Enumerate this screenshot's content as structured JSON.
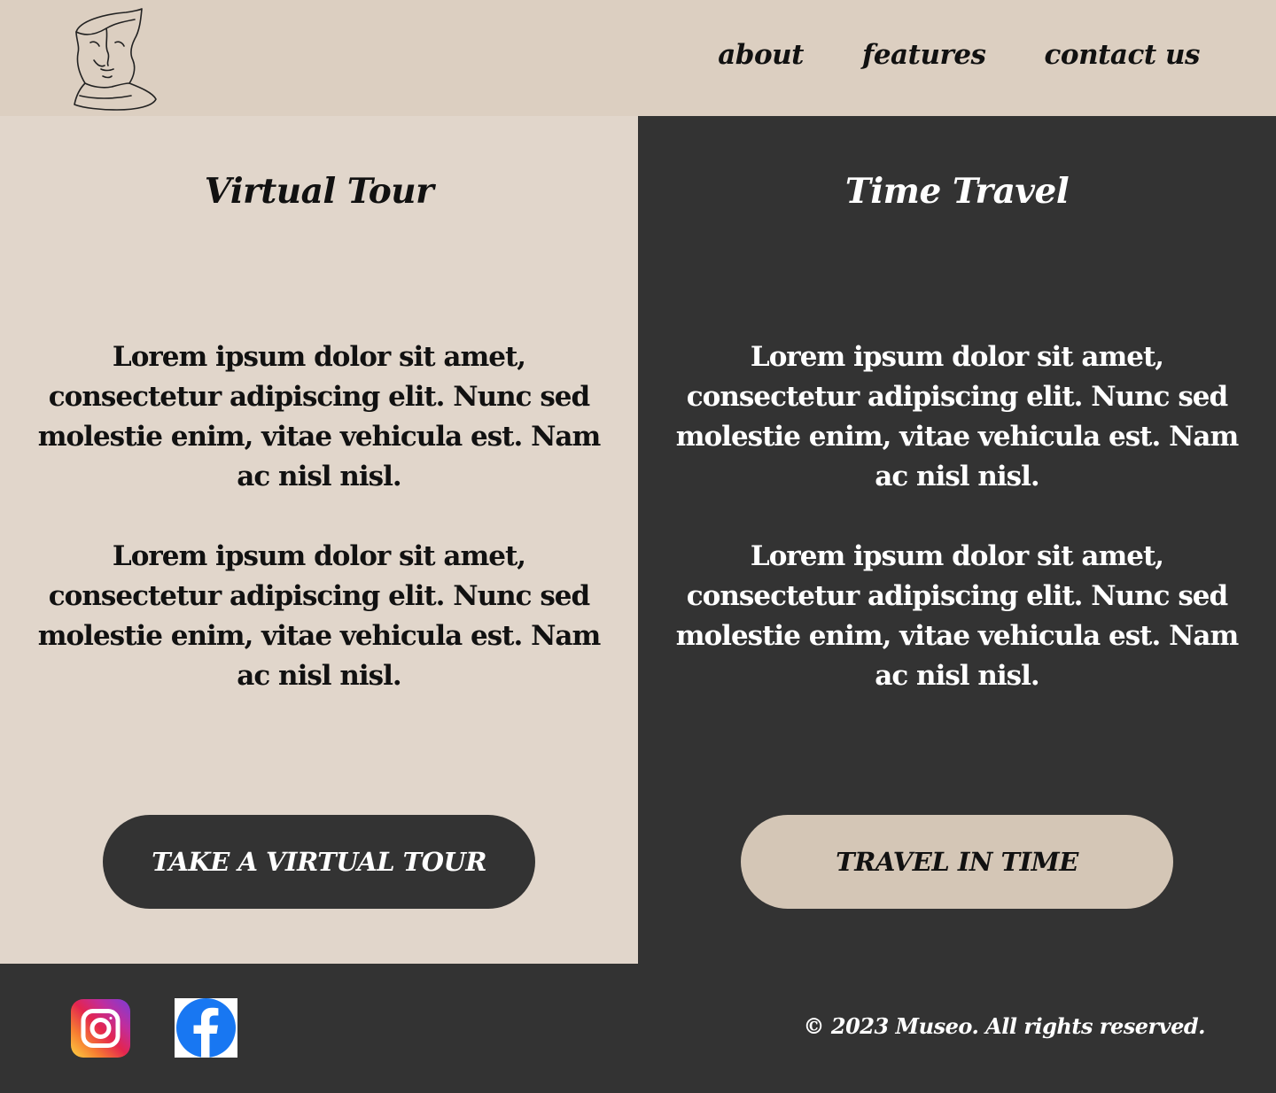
{
  "header": {
    "logo_icon": "sculpture-head-logo",
    "nav": {
      "about": "about",
      "features": "features",
      "contact": "contact us"
    }
  },
  "left_panel": {
    "title": "Virtual Tour",
    "paragraph1": "Lorem ipsum dolor sit amet, consectetur adipiscing elit. Nunc sed molestie enim, vitae vehicula est. Nam ac nisl nisl.",
    "paragraph2": "Lorem ipsum dolor sit amet, consectetur adipiscing elit. Nunc sed molestie enim, vitae vehicula est. Nam ac nisl nisl.",
    "button": "TAKE A VIRTUAL TOUR"
  },
  "right_panel": {
    "title": "Time Travel",
    "paragraph1": "Lorem ipsum dolor sit amet, consectetur adipiscing elit. Nunc sed molestie enim, vitae vehicula est. Nam ac nisl nisl.",
    "paragraph2": "Lorem ipsum dolor sit amet, consectetur adipiscing elit. Nunc sed molestie enim, vitae vehicula est. Nam ac nisl nisl.",
    "button": "TRAVEL IN TIME"
  },
  "footer": {
    "social": [
      "instagram-icon",
      "facebook-icon"
    ],
    "copyright": "© 2023 Museo. All rights reserved."
  },
  "colors": {
    "header_bg": "#dccfc1",
    "light_panel_bg": "#e1d6cb",
    "dark_bg": "#333333",
    "light_button_bg": "#d4c6b6",
    "facebook_blue": "#1877f2"
  }
}
